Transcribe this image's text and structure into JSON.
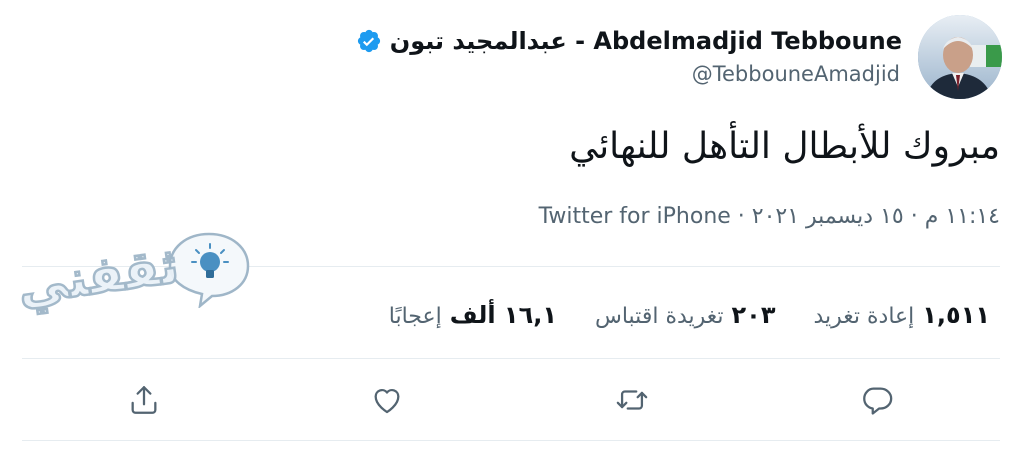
{
  "tweet": {
    "author": {
      "display_name": "عبدالمجيد تبون - Abdelmadjid Tebboune",
      "handle": "@TebbouneAmadjid",
      "verified": true
    },
    "text": "مبروك للأبطال التأهل للنهائي",
    "meta": "١١:١٤ م · ١٥ ديسمبر ٢٠٢١ · Twitter for iPhone",
    "stats": [
      {
        "number": "١,٥١١",
        "label": "إعادة تغريد"
      },
      {
        "number": "٢٠٣",
        "label": "تغريدة اقتباس"
      },
      {
        "number": "١٦,١ ألف",
        "label": "إعجابًا"
      }
    ],
    "actions": [
      {
        "name": "reply",
        "icon": "reply-icon"
      },
      {
        "name": "retweet",
        "icon": "retweet-icon"
      },
      {
        "name": "like",
        "icon": "heart-icon"
      },
      {
        "name": "share",
        "icon": "share-icon"
      }
    ]
  },
  "watermark": {
    "text": "ثقفني"
  },
  "colors": {
    "text_primary": "#0f1419",
    "text_secondary": "#536471",
    "verified_blue": "#1d9bf0",
    "divider": "#e6ecf0",
    "watermark_bulb": "#4a90c2"
  }
}
